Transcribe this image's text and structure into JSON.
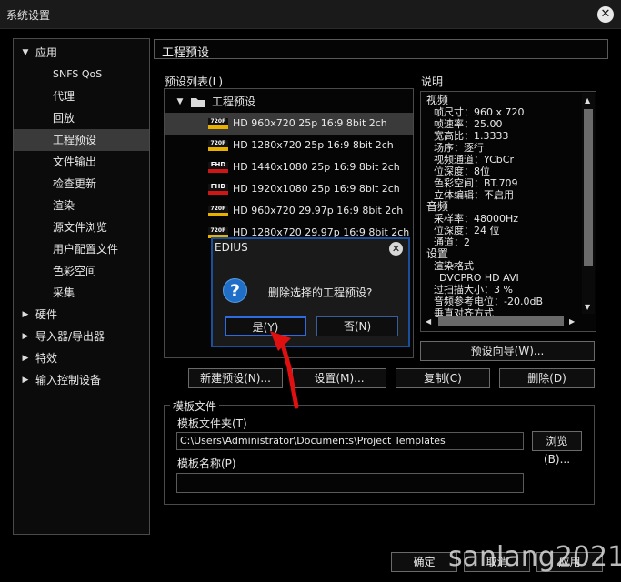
{
  "window": {
    "title": "系统设置"
  },
  "nav": {
    "items": [
      {
        "label": "应用",
        "caret": "▼"
      },
      {
        "label": "SNFS QoS"
      },
      {
        "label": "代理"
      },
      {
        "label": "回放"
      },
      {
        "label": "工程预设"
      },
      {
        "label": "文件输出"
      },
      {
        "label": "检查更新"
      },
      {
        "label": "渲染"
      },
      {
        "label": "源文件浏览"
      },
      {
        "label": "用户配置文件"
      },
      {
        "label": "色彩空间"
      },
      {
        "label": "采集"
      },
      {
        "label": "硬件",
        "caret": "▶"
      },
      {
        "label": "导入器/导出器",
        "caret": "▶"
      },
      {
        "label": "特效",
        "caret": "▶"
      },
      {
        "label": "输入控制设备",
        "caret": "▶"
      }
    ]
  },
  "page": {
    "title": "工程预设"
  },
  "preset_list": {
    "label": "预设列表(L)",
    "folder": "工程预设",
    "rows": [
      {
        "badge": "720P",
        "text": "HD 960x720 25p 16:9 8bit 2ch"
      },
      {
        "badge": "720P",
        "text": "HD 1280x720 25p 16:9 8bit 2ch"
      },
      {
        "badge": "FHD",
        "text": "HD 1440x1080 25p 16:9 8bit 2ch"
      },
      {
        "badge": "FHD",
        "text": "HD 1920x1080 25p 16:9 8bit 2ch"
      },
      {
        "badge": "720P",
        "text": "HD 960x720 29.97p 16:9 8bit 2ch"
      },
      {
        "badge": "720P",
        "text": "HD 1280x720 29.97p 16:9 8bit 2ch"
      }
    ]
  },
  "description": {
    "label": "说明",
    "lines": [
      "视频",
      "帧尺寸：960 x 720",
      "帧速率：25.00",
      "宽高比：1.3333",
      "场序：逐行",
      "视频通道：YCbCr",
      "位深度：8位",
      "色彩空间：BT.709",
      "立体编辑：不启用",
      "音频",
      "采样率：48000Hz",
      "位深度：24 位",
      "通道：2",
      "设置",
      "渲染格式",
      "DVCPRO HD AVI",
      "过扫描大小：3 %",
      "音频参考电位：-20.0dB",
      "垂直对齐方式"
    ]
  },
  "buttons": {
    "wizard": "预设向导(W)...",
    "new_preset": "新建预设(N)...",
    "settings": "设置(M)...",
    "copy": "复制(C)",
    "delete": "删除(D)",
    "browse": "浏览(B)...",
    "ok": "确定",
    "cancel": "取消",
    "apply": "应用"
  },
  "template": {
    "group_label": "模板文件",
    "folder_label": "模板文件夹(T)",
    "folder_value": "C:\\Users\\Administrator\\Documents\\Project Templates",
    "name_label": "模板名称(P)",
    "name_value": ""
  },
  "dialog": {
    "title": "EDIUS",
    "message": "删除选择的工程预设?",
    "yes": "是(Y)",
    "no": "否(N)"
  },
  "watermark": "sanlang2021"
}
